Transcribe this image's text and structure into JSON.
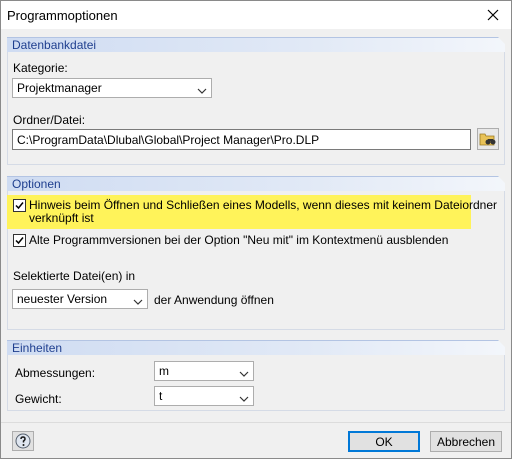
{
  "window": {
    "title": "Programmoptionen"
  },
  "datenbank": {
    "header": "Datenbankdatei",
    "kategorie_label": "Kategorie:",
    "kategorie_value": "Projektmanager",
    "ordner_label": "Ordner/Datei:",
    "ordner_value": "C:\\ProgramData\\Dlubal\\Global\\Project Manager\\Pro.DLP"
  },
  "optionen": {
    "header": "Optionen",
    "checkbox1_line1": "Hinweis beim Öffnen und Schließen eines Modells, wenn dieses mit keinem Dateiordner",
    "checkbox1_line2": "verknüpft ist",
    "checkbox1_checked": true,
    "checkbox2": "Alte Programmversionen bei der Option \"Neu mit\" im Kontextmenü ausblenden",
    "checkbox2_checked": true,
    "selektierte_label": "Selektierte Datei(en) in",
    "version_value": "neuester Version",
    "anwendung_label": "der Anwendung öffnen"
  },
  "einheiten": {
    "header": "Einheiten",
    "abmessungen_label": "Abmessungen:",
    "abmessungen_value": "m",
    "gewicht_label": "Gewicht:",
    "gewicht_value": "t"
  },
  "footer": {
    "ok_label": "OK",
    "cancel_label": "Abbrechen"
  },
  "colors": {
    "highlight": "#fff35a",
    "section_header_text": "#1f3f8f",
    "default_button_border": "#0078d7"
  }
}
